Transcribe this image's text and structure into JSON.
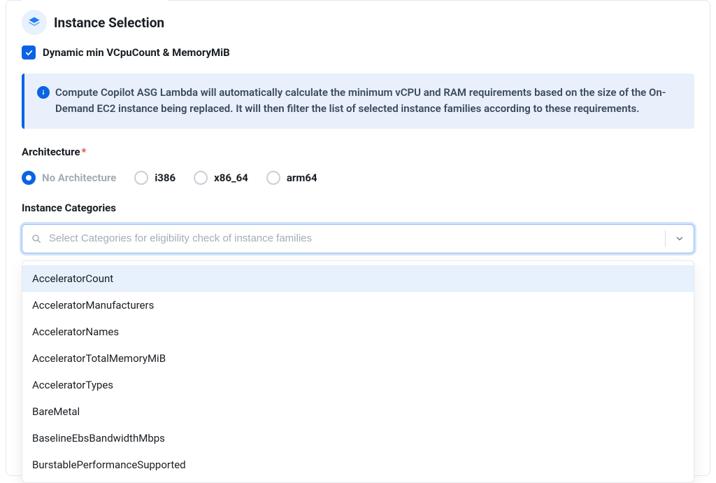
{
  "panel": {
    "title": "Instance Selection"
  },
  "dynamic_toggle": {
    "label": "Dynamic min VCpuCount & MemoryMiB",
    "checked": true
  },
  "info_banner": {
    "text": "Compute Copilot ASG Lambda will automatically calculate the minimum vCPU and RAM requirements based on the size of the On-Demand EC2 instance being replaced. It will then filter the list of selected instance families according to these requirements."
  },
  "architecture": {
    "label": "Architecture",
    "required_mark": "*",
    "options": [
      {
        "label": "No Architecture",
        "selected": true,
        "muted": true
      },
      {
        "label": "i386",
        "selected": false,
        "muted": false
      },
      {
        "label": "x86_64",
        "selected": false,
        "muted": false
      },
      {
        "label": "arm64",
        "selected": false,
        "muted": false
      }
    ]
  },
  "categories": {
    "label": "Instance Categories",
    "placeholder": "Select Categories for eligibility check of instance families",
    "options": [
      "AcceleratorCount",
      "AcceleratorManufacturers",
      "AcceleratorNames",
      "AcceleratorTotalMemoryMiB",
      "AcceleratorTypes",
      "BareMetal",
      "BaselineEbsBandwidthMbps",
      "BurstablePerformanceSupported"
    ],
    "highlighted_index": 0
  }
}
